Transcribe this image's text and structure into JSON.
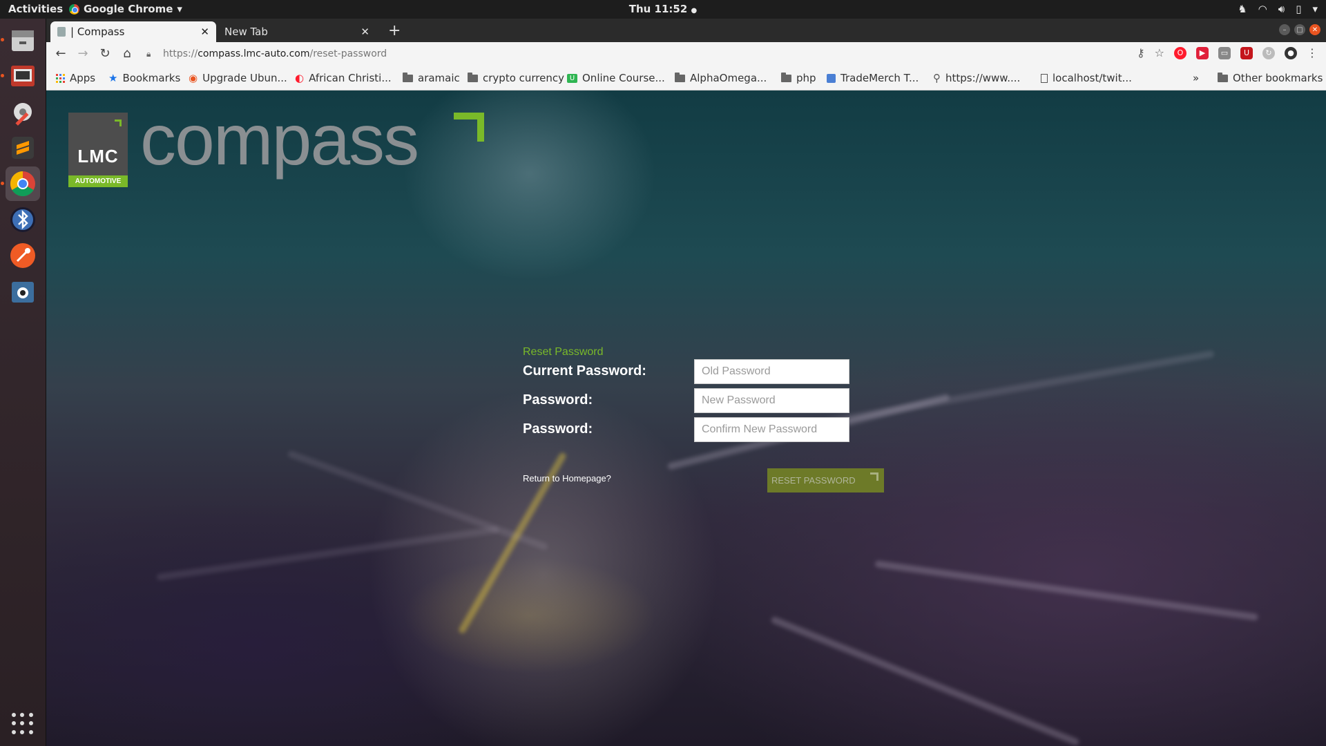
{
  "system_bar": {
    "activities": "Activities",
    "app_name": "Google Chrome",
    "clock": "Thu 11:52"
  },
  "browser": {
    "tabs": [
      {
        "label": "| Compass"
      },
      {
        "label": "New Tab"
      }
    ],
    "url": {
      "scheme": "https://",
      "host": "compass.lmc-auto.com",
      "path": "/reset-password"
    },
    "bookmarks": [
      {
        "label": "Apps",
        "icon": "apps-grid-icon"
      },
      {
        "label": "Bookmarks",
        "icon": "star-icon"
      },
      {
        "label": "Upgrade Ubun...",
        "icon": "ubuntu-icon"
      },
      {
        "label": "African Christi...",
        "icon": "opera-icon"
      },
      {
        "label": "aramaic",
        "icon": "folder-icon"
      },
      {
        "label": "crypto currency",
        "icon": "folder-icon"
      },
      {
        "label": "Online Course...",
        "icon": "udemy-icon"
      },
      {
        "label": "AlphaOmega...",
        "icon": "folder-icon"
      },
      {
        "label": "php",
        "icon": "folder-icon"
      },
      {
        "label": "TradeMerch T...",
        "icon": "doc-icon"
      },
      {
        "label": "https://www....",
        "icon": "site-icon"
      },
      {
        "label": "localhost/twit...",
        "icon": "page-icon"
      }
    ],
    "overflow": "»",
    "other_bookmarks": "Other bookmarks"
  },
  "brand": {
    "logo_text": "LMC",
    "logo_sub": "AUTOMOTIVE",
    "wordmark": "compass",
    "accent": "#7ab929"
  },
  "form": {
    "title": "Reset Password",
    "fields": [
      {
        "label": "Current Password:",
        "placeholder": "Old Password"
      },
      {
        "label": "Password:",
        "placeholder": "New Password"
      },
      {
        "label": "Password:",
        "placeholder": "Confirm New Password"
      }
    ],
    "return_link": "Return to Homepage?",
    "submit": "RESET PASSWORD"
  }
}
